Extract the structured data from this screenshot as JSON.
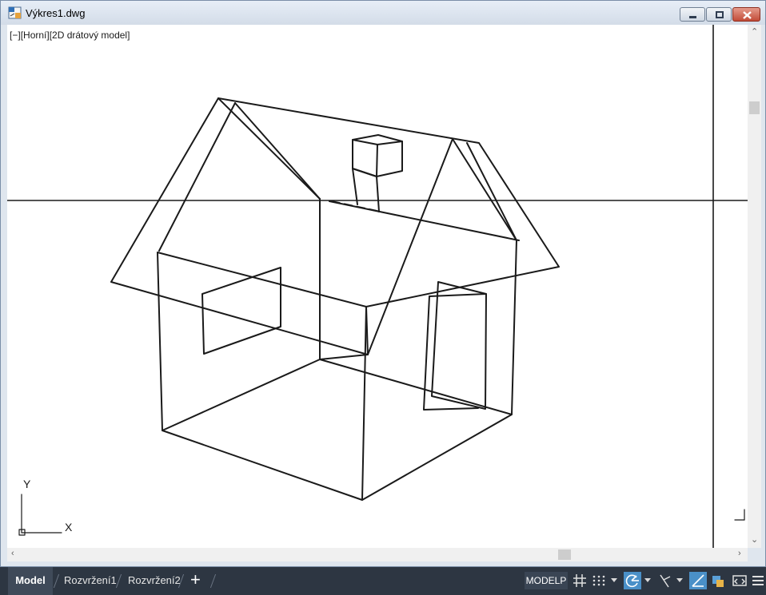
{
  "window": {
    "title": "Výkres1.dwg"
  },
  "viewport": {
    "controls": "[−]",
    "view": "[Horní]",
    "style": "[2D drátový model]",
    "ucs_y": "Y",
    "ucs_x": "X"
  },
  "tabs": [
    {
      "label": "Model",
      "active": true
    },
    {
      "label": "Rozvržení1",
      "active": false
    },
    {
      "label": "Rozvržení2",
      "active": false
    }
  ],
  "status": {
    "space": "MODELP",
    "icons": [
      "grid-icon",
      "snap-icon",
      "polar-tracking-icon",
      "isodraft-icon",
      "object-snap-tracking-icon",
      "annotation-icon",
      "fullscreen-icon",
      "menu-icon"
    ]
  },
  "colors": {
    "titlebar": "#dbe3ed",
    "statusbar": "#2d3642",
    "active_toggle": "#4a90c8",
    "close_button": "#c24c38"
  }
}
